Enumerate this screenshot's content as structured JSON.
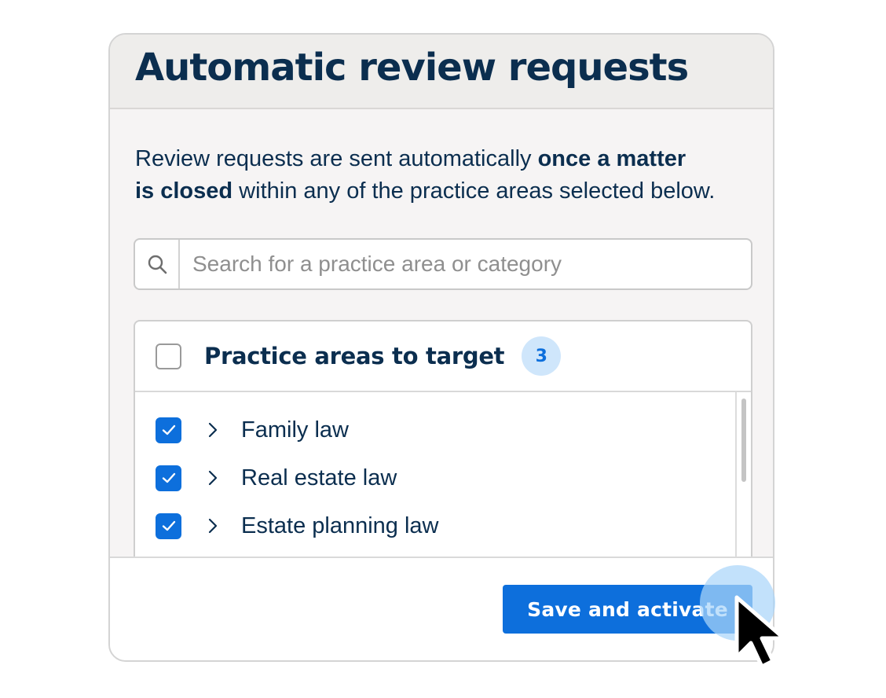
{
  "card": {
    "title": "Automatic review requests",
    "description": {
      "part1": "Review requests are sent automatically ",
      "bold1": "once a matter",
      "bold2": "is closed",
      "part2": " within any of the practice areas selected below."
    }
  },
  "search": {
    "placeholder": "Search for a practice area or category",
    "value": "",
    "icon": "search-icon"
  },
  "practice_areas": {
    "title": "Practice areas to target",
    "count": "3",
    "select_all_checked": false,
    "items": [
      {
        "label": "Family law",
        "checked": true,
        "icon": "chevron-right-icon"
      },
      {
        "label": "Real estate law",
        "checked": true,
        "icon": "chevron-right-icon"
      },
      {
        "label": "Estate planning law",
        "checked": true,
        "icon": "chevron-right-icon"
      }
    ]
  },
  "footer": {
    "save_label": "Save and activate"
  },
  "colors": {
    "primary": "#0d6fdc",
    "text": "#0b2e4f",
    "badge_bg": "#cfe6fb",
    "header_bg": "#eeedeb",
    "card_bg": "#f6f4f4"
  }
}
